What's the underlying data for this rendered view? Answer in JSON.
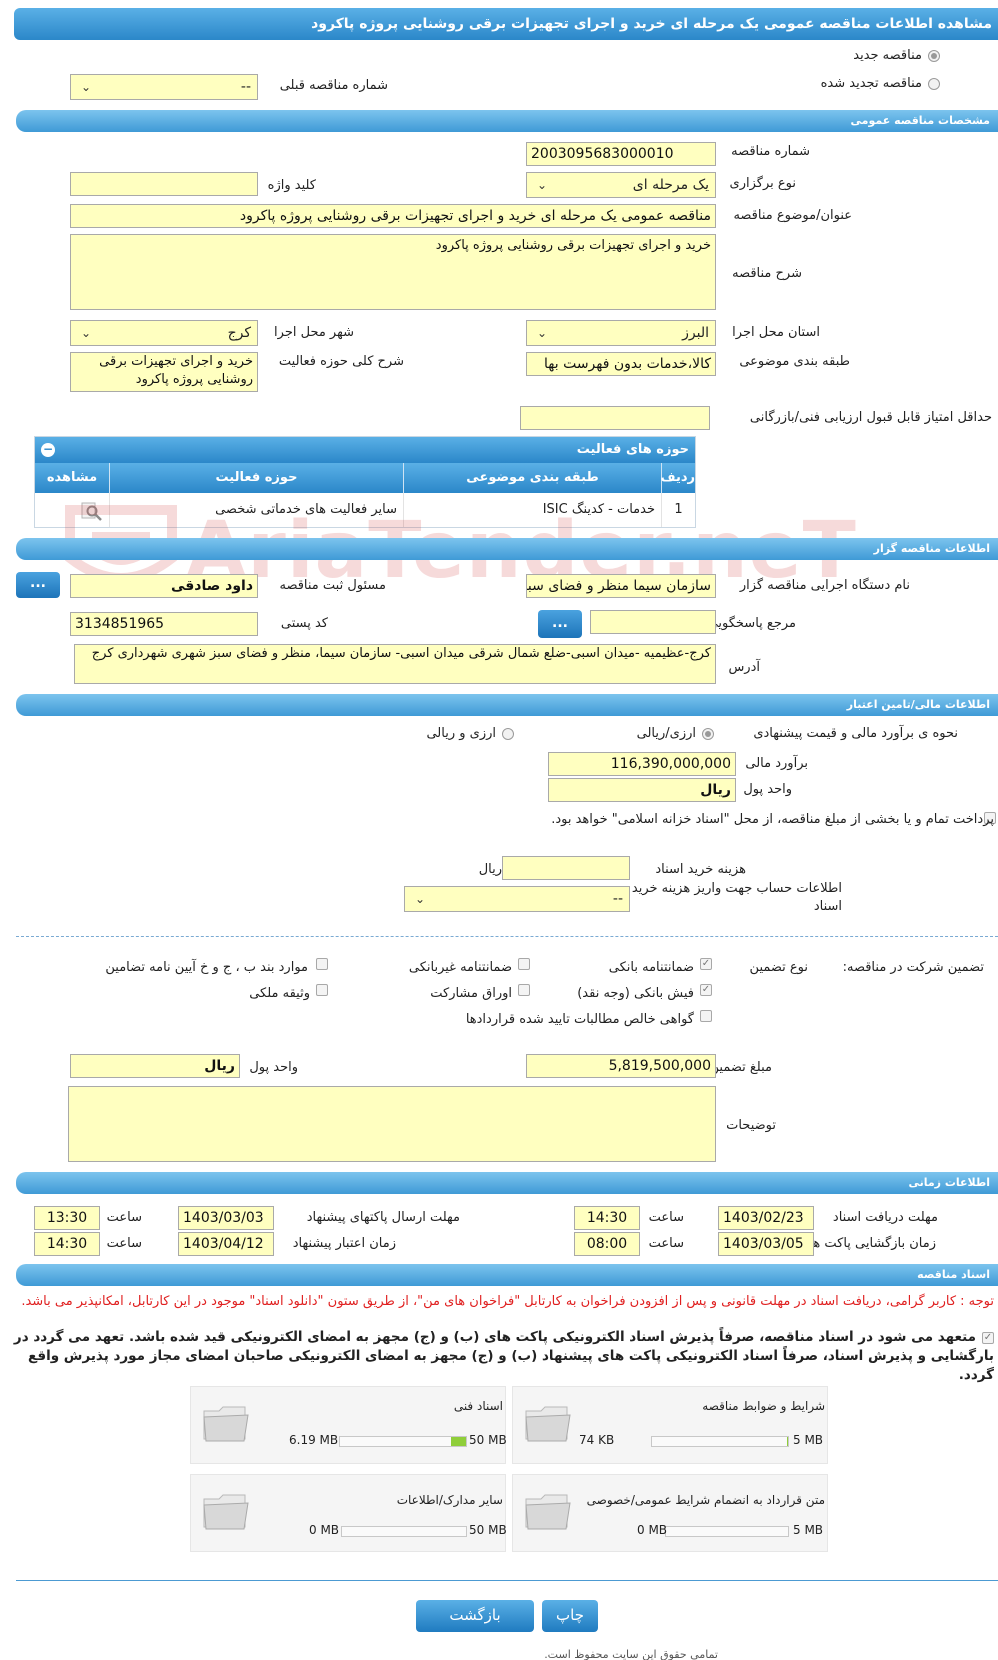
{
  "title": "مشاهده اطلاعات مناقصه عمومی یک مرحله ای خرید و اجرای تجهیزات برقی روشنایی پروژه پاکرود",
  "top": {
    "radio_new": "مناقصه جدید",
    "radio_renewed": "مناقصه تجدید شده",
    "prev_number_label": "شماره مناقصه قبلی",
    "prev_number_value": "--"
  },
  "general": {
    "header": "مشخصات مناقصه عمومی",
    "number_label": "شماره مناقصه",
    "number_value": "2003095683000010",
    "type_label": "نوع برگزاری",
    "type_value": "یک مرحله ای",
    "keyword_label": "کلید واژه",
    "keyword_value": "",
    "subject_label": "عنوان/موضوع مناقصه",
    "subject_value": "مناقصه عمومی یک مرحله ای خرید و اجرای تجهیزات برقی روشنایی پروژه پاکرود",
    "desc_label": "شرح مناقصه",
    "desc_value": "خرید و اجرای تجهیزات برقی روشنایی پروژه پاکرود",
    "province_label": "استان محل اجرا",
    "province_value": "البرز",
    "city_label": "شهر محل اجرا",
    "city_value": "کرج",
    "category_label": "طبقه بندی موضوعی",
    "category_value": "کالا،خدمات بدون فهرست بها",
    "activity_desc_label": "شرح کلی حوزه فعالیت",
    "activity_desc_value": "خرید و اجرای تجهیزات برقی روشنایی پروژه پاکرود",
    "min_score_label": "حداقل امتیاز قابل قبول ارزیابی فنی/بازرگانی",
    "min_score_value": ""
  },
  "activities": {
    "header": "حوزه های فعالیت",
    "columns": [
      "ردیف",
      "طبقه بندی موضوعی",
      "حوزه فعالیت",
      "مشاهده"
    ],
    "rows": [
      {
        "row": "1",
        "category": "خدمات - کدینگ ISIC",
        "field": "سایر فعالیت های خدماتی شخصی"
      }
    ]
  },
  "watermark": "AriaTender.neT",
  "organizer": {
    "header": "اطلاعات مناقصه گزار",
    "org_label": "نام دستگاه اجرایی مناقصه گزار",
    "org_value": "سازمان سیما منظر و فضای سبز شهری شهرداری کرج",
    "responsible_label": "مسئول ثبت مناقصه",
    "responsible_value": "داود صادقی",
    "reference_label": "مرجع پاسخگویی",
    "reference_value": "",
    "postal_label": "کد پستی",
    "postal_value": "3134851965",
    "address_label": "آدرس",
    "address_value": "کرج-عظیمیه -میدان اسبی-ضلع شمال شرقی میدان اسبی- سازمان سیما، منظر و فضای سبز شهری شهرداری کرج",
    "dots": "..."
  },
  "finance": {
    "header": "اطلاعات مالی/تامین اعتبار",
    "method_label": "نحوه ی برآورد مالی و قیمت پیشنهادی",
    "method_opt1": "ارزی/ریالی",
    "method_opt2": "ارزی و ریالی",
    "estimate_label": "برآورد مالی",
    "estimate_value": "116,390,000,000",
    "currency_label": "واحد پول",
    "currency_value": "ریال",
    "treasury_text": "پرداخت تمام و یا بخشی از مبلغ مناقصه، از محل \"اسناد خزانه اسلامی\" خواهد بود.",
    "doc_cost_label": "هزینه خرید اسناد",
    "doc_cost_value": "",
    "doc_cost_unit": "ریال",
    "account_label": "اطلاعات حساب جهت واریز هزینه خرید اسناد",
    "account_value": "--"
  },
  "guarantee": {
    "label": "تضمین شرکت در مناقصه:",
    "type_label": "نوع تضمین",
    "options": [
      {
        "label": "ضمانتنامه بانکی",
        "checked": true
      },
      {
        "label": "ضمانتنامه غیربانکی",
        "checked": false
      },
      {
        "label": "موارد بند ب ، ج و خ آیین نامه تضامین",
        "checked": false
      },
      {
        "label": "فیش بانکی (وجه نقد)",
        "checked": true
      },
      {
        "label": "اوراق مشارکت",
        "checked": false
      },
      {
        "label": "وثیقه ملکی",
        "checked": false
      },
      {
        "label": "گواهی خالص مطالبات تایید شده قراردادها",
        "checked": false
      }
    ],
    "amount_label": "مبلغ تضمین",
    "amount_value": "5,819,500,000",
    "currency_label": "واحد پول",
    "currency_value": "ریال",
    "notes_label": "توضیحات",
    "notes_value": ""
  },
  "timing": {
    "header": "اطلاعات زمانی",
    "receive_label": "مهلت دریافت اسناد",
    "receive_date": "1403/02/23",
    "receive_time": "14:30",
    "send_label": "مهلت ارسال پاکتهای پیشنهاد",
    "send_date": "1403/03/03",
    "send_time": "13:30",
    "open_label": "زمان بازگشایی پاکت ها",
    "open_date": "1403/03/05",
    "open_time": "08:00",
    "validity_label": "زمان اعتبار پیشنهاد",
    "validity_date": "1403/04/12",
    "validity_time": "14:30",
    "time_label": "ساعت"
  },
  "docs": {
    "header": "اسناد مناقصه",
    "notice": "توجه : کاربر گرامی، دریافت اسناد در مهلت قانونی و پس از افزودن فراخوان به کارتابل \"فراخوان های من\"، از طریق ستون \"دانلود اسناد\" موجود در این کارتابل، امکانپذیر می باشد.",
    "commitment": "متعهد می شود در اسناد مناقصه، صرفاً پذیرش اسناد الکترونیکی پاکت های (ب) و (ج) مجهز به امضای الکترونیکی قید شده باشد. تعهد می گردد در بارگشایی و پذیرش اسناد، صرفاً اسناد الکترونیکی پاکت های پیشنهاد (ب) و (ج) مجهز به امضای الکترونیکی صاحبان امضای مجاز مورد پذیرش واقع گردد.",
    "cards": [
      {
        "name": "شرایط و ضوابط مناقصه",
        "used": "74 KB",
        "max": "5 MB",
        "fill": 0.01
      },
      {
        "name": "اسناد فنی",
        "used": "6.19 MB",
        "max": "50 MB",
        "fill": 0.12
      },
      {
        "name": "متن قرارداد به انضمام شرایط عمومی/خصوصی",
        "used": "0 MB",
        "max": "5 MB",
        "fill": 0
      },
      {
        "name": "سایر مدارک/اطلاعات",
        "used": "0 MB",
        "max": "50 MB",
        "fill": 0
      }
    ]
  },
  "footer": {
    "back": "بازگشت",
    "print": "چاپ",
    "copyright": "تمامی حقوق این سایت محفوظ است."
  }
}
